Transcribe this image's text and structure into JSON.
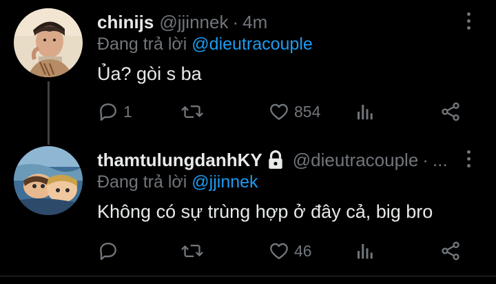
{
  "tweets": [
    {
      "name": "chinijs",
      "handle": "@jjinnek",
      "separator": "·",
      "time": "4m",
      "replying_prefix": "Đang trả lời",
      "replying_to": "@dieutracouple",
      "text": "Ủa? gòi s ba",
      "reply_count": "1",
      "retweet_count": "",
      "like_count": "854",
      "locked": false
    },
    {
      "name": "thamtulungdanhKY",
      "handle": "@dieutracouple",
      "separator": "·",
      "time": "...",
      "replying_prefix": "Đang trả lời",
      "replying_to": "@jjinnek",
      "text": "Không có sự trùng hợp ở đây cả, big bro",
      "reply_count": "",
      "retweet_count": "",
      "like_count": "46",
      "locked": true
    }
  ],
  "icons": {
    "reply": "reply-icon",
    "retweet": "retweet-icon",
    "like": "heart-icon",
    "views": "views-icon",
    "share": "share-icon",
    "more": "more-options-icon",
    "lock": "lock-icon"
  },
  "colors": {
    "background": "#000000",
    "text": "#e7e9ea",
    "secondary": "#71767b",
    "link": "#1d9bf0"
  }
}
